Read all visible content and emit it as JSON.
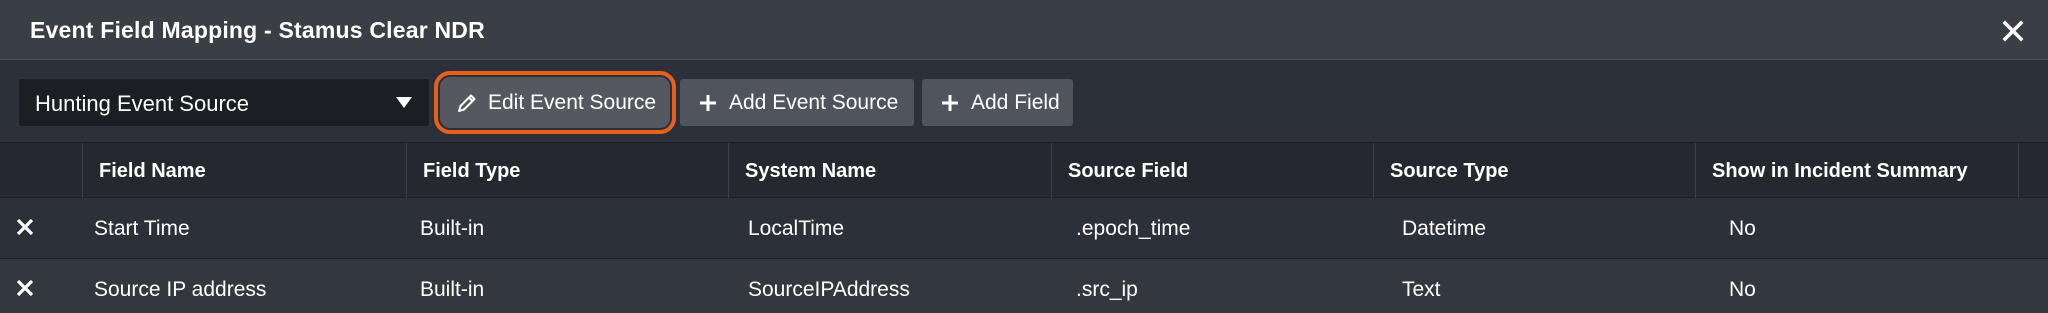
{
  "dialog": {
    "title": "Event Field Mapping - Stamus Clear NDR",
    "close_icon": "close-icon"
  },
  "toolbar": {
    "source_select": {
      "selected": "Hunting Event Source"
    },
    "edit_label": "Edit Event Source",
    "add_source_label": "Add Event Source",
    "add_field_label": "Add Field",
    "highlight_color": "#e8601c"
  },
  "table": {
    "headers": [
      "Field Name",
      "Field Type",
      "System Name",
      "Source Field",
      "Source Type",
      "Show in Incident Summary"
    ],
    "rows": [
      {
        "field_name": "Start Time",
        "field_type": "Built-in",
        "system_name": "LocalTime",
        "source_field": ".epoch_time",
        "source_type": "Datetime",
        "show_in_summary": "No"
      },
      {
        "field_name": "Source IP address",
        "field_type": "Built-in",
        "system_name": "SourceIPAddress",
        "source_field": ".src_ip",
        "source_type": "Text",
        "show_in_summary": "No"
      }
    ]
  }
}
